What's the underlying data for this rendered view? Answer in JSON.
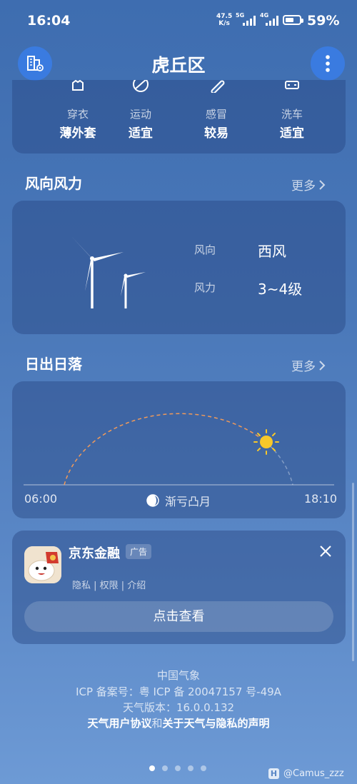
{
  "status_bar": {
    "time": "16:04",
    "net_speed_value": "47.5",
    "net_speed_unit": "K/s",
    "sim1_type": "5G",
    "sim2_type": "4G",
    "battery_percent": "59%",
    "battery_level": 0.59
  },
  "header": {
    "title": "虎丘区"
  },
  "living": {
    "items": [
      {
        "label": "穿衣",
        "value": "薄外套",
        "icon": "shirt-icon"
      },
      {
        "label": "运动",
        "value": "适宜",
        "icon": "ball-icon"
      },
      {
        "label": "感冒",
        "value": "较易",
        "icon": "pill-icon"
      },
      {
        "label": "洗车",
        "value": "适宜",
        "icon": "car-icon"
      }
    ]
  },
  "wind": {
    "section_title": "风向风力",
    "more_label": "更多",
    "direction_label": "风向",
    "direction_value": "西风",
    "force_label": "风力",
    "force_value": "3~4级"
  },
  "sun": {
    "section_title": "日出日落",
    "more_label": "更多",
    "sunrise": "06:00",
    "sunset": "18:10",
    "moon_phase": "渐亏凸月"
  },
  "ad": {
    "title": "京东金融",
    "badge": "广告",
    "links": "隐私 | 权限 | 介绍",
    "button_label": "点击查看"
  },
  "footer": {
    "source": "中国气象",
    "icp": "ICP 备案号：粤 ICP 备 20047157 号-49A",
    "version": "天气版本：16.0.0.132",
    "agreement_part1": "天气用户协议",
    "agreement_and": "和",
    "agreement_part2": "关于天气与隐私的声明"
  },
  "pager": {
    "active_index": 0,
    "count": 5
  },
  "watermark": {
    "text": "@Camus_zzz"
  },
  "colors": {
    "background_top": "#3e6db0",
    "background_bottom": "#6d9ad5",
    "button_blue": "#3a7be0",
    "sun_yellow": "#f7c82a",
    "arc_orange": "#f09a5a"
  }
}
